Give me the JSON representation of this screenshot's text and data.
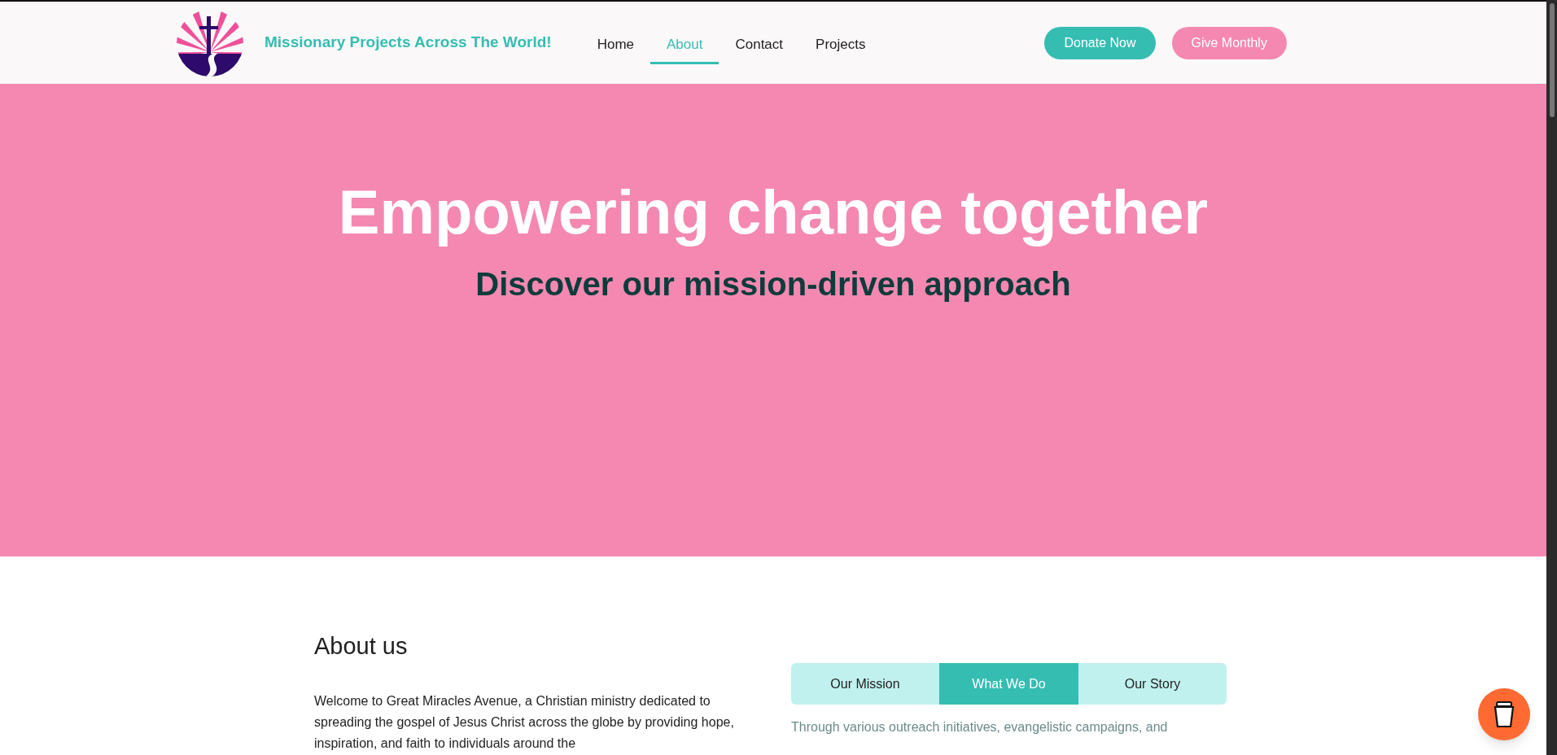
{
  "header": {
    "site_title": "Missionary Projects Across The World!",
    "nav": [
      {
        "label": "Home",
        "selected": false
      },
      {
        "label": "About",
        "selected": true
      },
      {
        "label": "Contact",
        "selected": false
      },
      {
        "label": "Projects",
        "selected": false
      }
    ],
    "buttons": [
      {
        "label": "Donate Now",
        "kind": "primary"
      },
      {
        "label": "Give Monthly",
        "kind": "secondary"
      }
    ]
  },
  "hero": {
    "title": "Empowering change together",
    "subtitle": "Discover our mission-driven approach"
  },
  "about": {
    "heading": "About us",
    "paragraph": "Welcome to Great Miracles Avenue, a Christian ministry dedicated to spreading the gospel of Jesus Christ across the globe by providing hope, inspiration, and faith to individuals around the",
    "tabs": [
      {
        "label": "Our Mission",
        "selected": false
      },
      {
        "label": "What We Do",
        "selected": true
      },
      {
        "label": "Our Story",
        "selected": false
      }
    ],
    "tab_text": "Through various outreach initiatives, evangelistic campaigns, and"
  }
}
